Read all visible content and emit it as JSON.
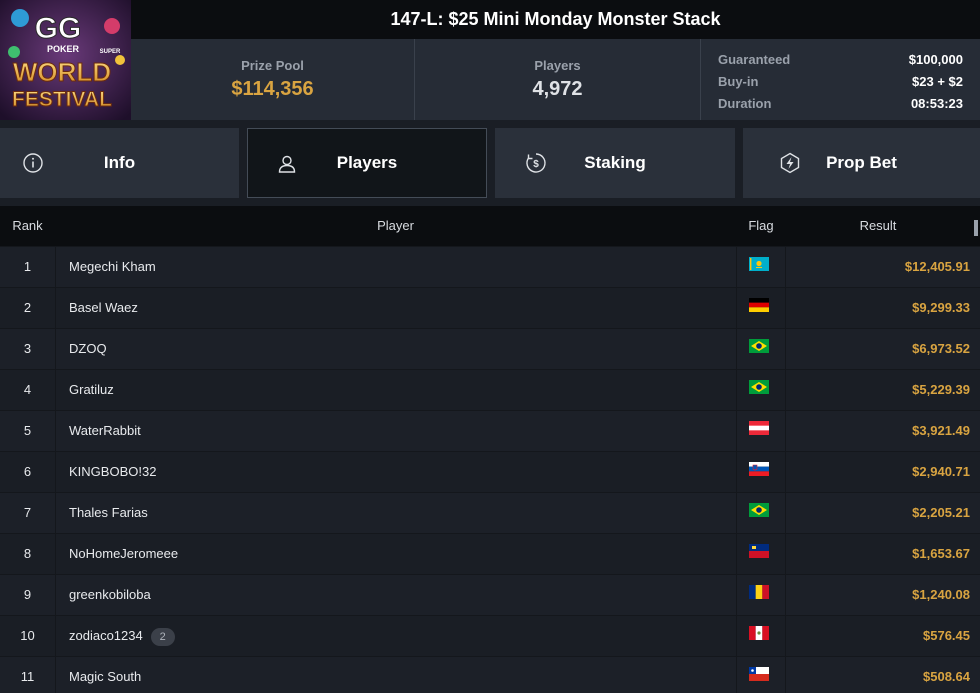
{
  "header": {
    "logo": {
      "line1": "GG",
      "line2": "POKER",
      "line3": "WORLD",
      "line4": "FESTIVAL",
      "super": "SUPER"
    },
    "title": "147-L: $25 Mini Monday Monster Stack",
    "prize_pool_label": "Prize Pool",
    "prize_pool_value": "$114,356",
    "players_label": "Players",
    "players_value": "4,972",
    "details": [
      {
        "label": "Guaranteed",
        "value": "$100,000"
      },
      {
        "label": "Buy-in",
        "value": "$23 + $2"
      },
      {
        "label": "Duration",
        "value": "08:53:23"
      }
    ]
  },
  "tabs": [
    {
      "label": "Info",
      "icon": "info-icon"
    },
    {
      "label": "Players",
      "icon": "user-icon",
      "active": true
    },
    {
      "label": "Staking",
      "icon": "dollar-coin-icon"
    },
    {
      "label": "Prop Bet",
      "icon": "prop-bet-icon"
    }
  ],
  "table": {
    "headers": {
      "rank": "Rank",
      "player": "Player",
      "flag": "Flag",
      "result": "Result"
    },
    "rows": [
      {
        "rank": "1",
        "player": "Megechi Kham",
        "flag": "kazakhstan",
        "result": "$12,405.91"
      },
      {
        "rank": "2",
        "player": "Basel Waez",
        "flag": "germany",
        "result": "$9,299.33"
      },
      {
        "rank": "3",
        "player": "DZOQ",
        "flag": "brazil",
        "result": "$6,973.52"
      },
      {
        "rank": "4",
        "player": "Gratiluz",
        "flag": "brazil",
        "result": "$5,229.39"
      },
      {
        "rank": "5",
        "player": "WaterRabbit",
        "flag": "austria",
        "result": "$3,921.49"
      },
      {
        "rank": "6",
        "player": "KINGBOBO!32",
        "flag": "slovenia",
        "result": "$2,940.71"
      },
      {
        "rank": "7",
        "player": "Thales Farias",
        "flag": "brazil",
        "result": "$2,205.21"
      },
      {
        "rank": "8",
        "player": "NoHomeJeromeee",
        "flag": "liechtenstein",
        "result": "$1,653.67"
      },
      {
        "rank": "9",
        "player": "greenkobiloba",
        "flag": "romania",
        "result": "$1,240.08"
      },
      {
        "rank": "10",
        "player": "zodiaco1234",
        "badge": "2",
        "flag": "peru",
        "result": "$576.45"
      },
      {
        "rank": "11",
        "player": "Magic South",
        "flag": "chile",
        "result": "$508.64"
      }
    ]
  },
  "colors": {
    "accent": "#d9a441",
    "background": "#1b1f26",
    "header_dark": "#0b0d10",
    "panel": "#262c36"
  }
}
